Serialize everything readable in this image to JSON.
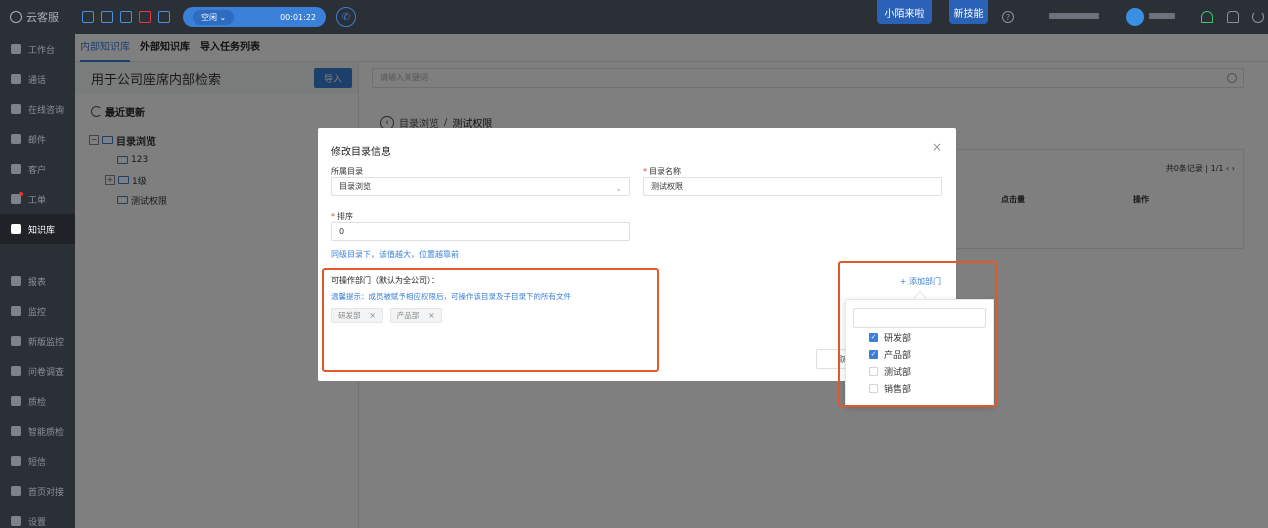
{
  "app": {
    "name": "云客服"
  },
  "sidebar": {
    "items": [
      {
        "label": "工作台"
      },
      {
        "label": "通话"
      },
      {
        "label": "在线咨询"
      },
      {
        "label": "邮件"
      },
      {
        "label": "客户"
      },
      {
        "label": "工单"
      },
      {
        "label": "知识库"
      },
      {
        "label": "报表"
      },
      {
        "label": "监控"
      },
      {
        "label": "新版监控"
      },
      {
        "label": "问卷调查"
      },
      {
        "label": "质检"
      },
      {
        "label": "智能质检"
      },
      {
        "label": "短信"
      },
      {
        "label": "首页对接"
      },
      {
        "label": "设置"
      }
    ]
  },
  "topbar": {
    "status": "空闲",
    "timer": "00:01:22",
    "badge_left": "小陌来啦",
    "badge_right": "新技能",
    "help": "?"
  },
  "tabs": [
    "内部知识库",
    "外部知识库",
    "导入任务列表"
  ],
  "left_panel": {
    "title": "用于公司座席内部检索",
    "import_label": "导入",
    "recent_label": "最近更新",
    "tree": {
      "root": "目录浏览",
      "children": [
        "123",
        "1级",
        "测试权限"
      ]
    }
  },
  "right_panel": {
    "search_placeholder": "请输入关键词",
    "breadcrumb_root": "目录浏览",
    "breadcrumb_sep": "/",
    "breadcrumb_current": "测试权限",
    "pager": "共0条记录 | 1/1  ‹  ›",
    "columns": [
      "点击量",
      "操作"
    ]
  },
  "modal": {
    "title": "修改目录信息",
    "close": "×",
    "parent_label": "所属目录",
    "parent_value": "目录浏览",
    "name_label": "目录名称",
    "name_value": "测试权限",
    "sort_label": "排序",
    "sort_value": "0",
    "sort_hint": "同级目录下，该值越大，位置越靠前",
    "dept_label": "可操作部门（默认为全公司）：",
    "dept_warn": "温馨提示：成员被赋予相应权限后，可操作该目录及子目录下的所有文件",
    "tags": [
      "研发部",
      "产品部"
    ],
    "add_dept": "+  添加部门",
    "footer_partial": "取"
  },
  "dropdown": {
    "options": [
      {
        "label": "研发部",
        "checked": true
      },
      {
        "label": "产品部",
        "checked": true
      },
      {
        "label": "测试部",
        "checked": false
      },
      {
        "label": "销售部",
        "checked": false
      }
    ]
  },
  "colors": {
    "accent": "#3a7fd8",
    "highlight": "#e2572b",
    "sidebar": "#2b2f36"
  }
}
